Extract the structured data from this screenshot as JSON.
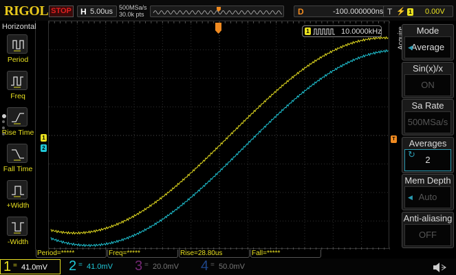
{
  "header": {
    "logo": "RIGOL",
    "run_state": "STOP",
    "timebase_label": "H",
    "timebase": "5.00us",
    "sample_rate": "500MSa/s",
    "memory_points": "30.0k pts",
    "delay_label": "D",
    "delay": "-100.000000ns",
    "trigger_label": "T",
    "trigger_source": "1",
    "trigger_level": "0.00V"
  },
  "left_menu": {
    "title": "Horizontal",
    "items": [
      {
        "label": "Period"
      },
      {
        "label": "Freq"
      },
      {
        "label": "Rise Time"
      },
      {
        "label": "Fall Time"
      },
      {
        "label": "+Width"
      },
      {
        "label": "-Width"
      }
    ]
  },
  "frequency_counter": {
    "channel": "1",
    "value": "10.0000kHz"
  },
  "channel_markers": {
    "ch1": "1",
    "ch2": "2",
    "trigger": "T"
  },
  "right_menu": {
    "title": "Acquire",
    "items": [
      {
        "label": "Mode",
        "value": "Average"
      },
      {
        "label": "Sin(x)/x",
        "value": "ON"
      },
      {
        "label": "Sa Rate",
        "value": "500MSa/s"
      },
      {
        "label": "Averages",
        "value": "2"
      },
      {
        "label": "Mem Depth",
        "value": "Auto"
      },
      {
        "label": "Anti-aliasing",
        "value": "OFF"
      }
    ]
  },
  "measurements": [
    "Period=*****",
    "Freq=*****",
    "Rise=28.80us",
    "Fall=*****"
  ],
  "channels": [
    {
      "number": "1",
      "coupling": "=",
      "scale": "41.0mV",
      "color": "#e8e020",
      "active": true
    },
    {
      "number": "2",
      "coupling": "=",
      "scale": "41.0mV",
      "color": "#20c8d8",
      "active": true
    },
    {
      "number": "3",
      "coupling": "=",
      "scale": "20.0mV",
      "color": "#c040c0",
      "active": false
    },
    {
      "number": "4",
      "coupling": "=",
      "scale": "50.0mV",
      "color": "#3070e0",
      "active": false
    }
  ],
  "colors": {
    "ch1": "#e8e020",
    "ch2": "#20c8d8",
    "trigger": "#f08a20"
  }
}
